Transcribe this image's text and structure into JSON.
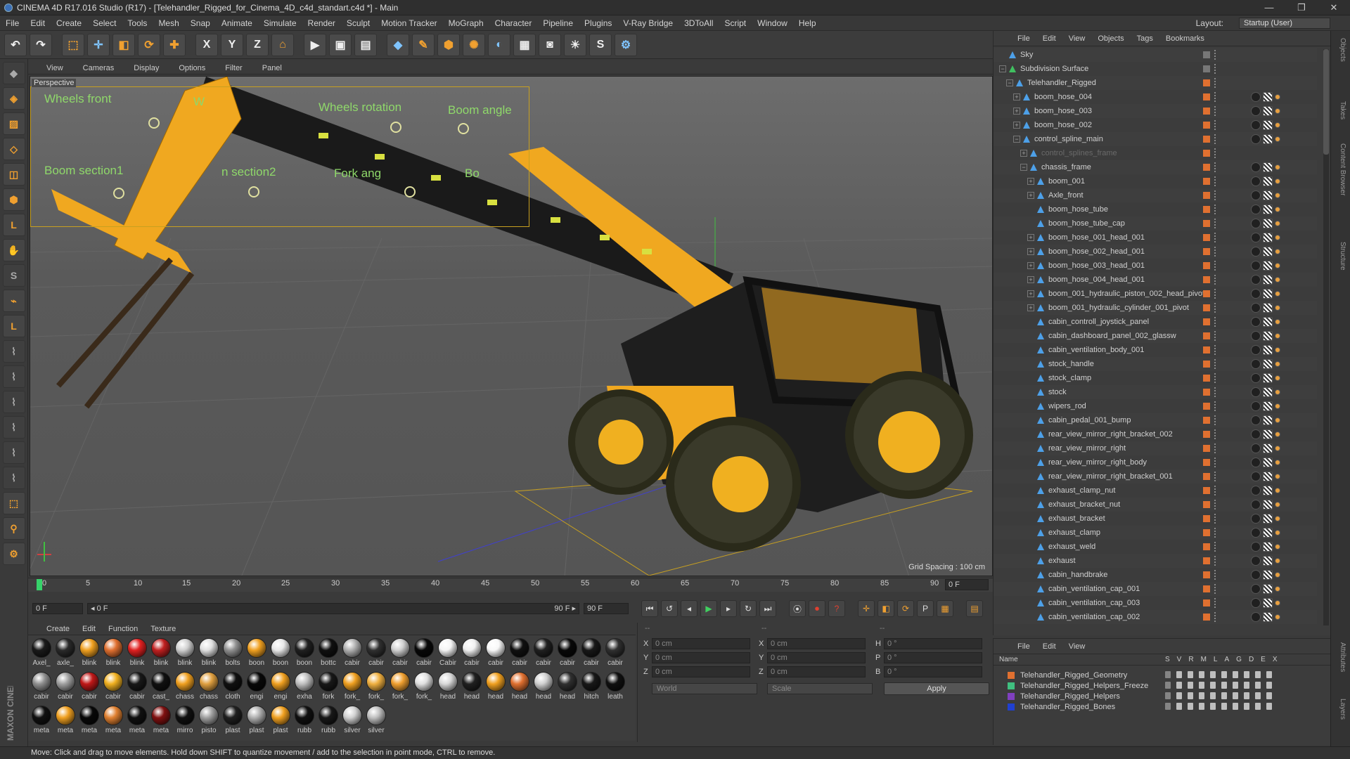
{
  "window": {
    "title": "CINEMA 4D R17.016 Studio (R17) - [Telehandler_Rigged_for_Cinema_4D_c4d_standart.c4d *] - Main",
    "minimize": "—",
    "maximize": "❐",
    "close": "✕"
  },
  "menubar": {
    "items": [
      "File",
      "Edit",
      "Create",
      "Select",
      "Tools",
      "Mesh",
      "Snap",
      "Animate",
      "Simulate",
      "Render",
      "Sculpt",
      "Motion Tracker",
      "MoGraph",
      "Character",
      "Pipeline",
      "Plugins",
      "V-Ray Bridge",
      "3DToAll",
      "Script",
      "Window",
      "Help"
    ],
    "layout_label": "Layout:",
    "layout_value": "Startup (User)"
  },
  "toolbar": {
    "undo": "↶",
    "redo": "↷",
    "select": "⬚",
    "move": "✛",
    "scale": "◧",
    "rotate": "⟳",
    "move2": "✚",
    "x": "X",
    "y": "Y",
    "z": "Z",
    "coord": "⌂",
    "render": "▶",
    "render2": "▣",
    "render3": "▤",
    "cube": "◆",
    "pen": "✎",
    "subdiv": "⬢",
    "array": "✺",
    "deform": "◐",
    "floor": "▦",
    "camera": "◙",
    "light": "☀",
    "python": "S",
    "python2": "⚙"
  },
  "left_tools": [
    "◆",
    "◈",
    "▨",
    "◇",
    "◫",
    "⬢",
    "L",
    "✋",
    "S",
    "⌁",
    "L",
    "⌇",
    "⌇",
    "⌇",
    "⌇",
    "⌇",
    "⌇",
    "⬚",
    "⚲",
    "⚙"
  ],
  "viewport": {
    "menu": [
      "View",
      "Cameras",
      "Display",
      "Options",
      "Filter",
      "Panel"
    ],
    "label": "Perspective",
    "grid_spacing": "Grid Spacing : 100 cm",
    "controls": [
      "Wheels front",
      "W",
      "Wheels rotation",
      "Boom angle",
      "Boom section1",
      "n section2",
      "Fork ang",
      "Bo"
    ]
  },
  "timeline": {
    "ticks": [
      "0",
      "5",
      "10",
      "15",
      "20",
      "25",
      "30",
      "35",
      "40",
      "45",
      "50",
      "55",
      "60",
      "65",
      "70",
      "75",
      "80",
      "85",
      "90"
    ],
    "frame_field": "0 F"
  },
  "transport": {
    "start_field": "0 F",
    "range_start": "◂ 0 F",
    "range_end": "90 F ▸",
    "end_field": "90 F",
    "buttons": [
      "⏮",
      "↺",
      "◂",
      "▶",
      "▸",
      "↻",
      "⏭",
      "⦿",
      "⏺",
      "?",
      "✛",
      "◧",
      "⟳",
      "P",
      "▦",
      "▤"
    ]
  },
  "materials": {
    "menu": [
      "Create",
      "Edit",
      "Function",
      "Texture"
    ],
    "items": [
      {
        "label": "Axel_",
        "color": "#1a1a1a"
      },
      {
        "label": "axle_",
        "color": "#2a2a2a"
      },
      {
        "label": "blink",
        "color": "#f0a020"
      },
      {
        "label": "blink",
        "color": "#e07030"
      },
      {
        "label": "blink",
        "color": "#e02020"
      },
      {
        "label": "blink",
        "color": "#c02020"
      },
      {
        "label": "blink",
        "color": "#d0d0d0"
      },
      {
        "label": "blink",
        "color": "#e0e0e0"
      },
      {
        "label": "bolts",
        "color": "#909090"
      },
      {
        "label": "boon",
        "color": "#f0a020"
      },
      {
        "label": "boon",
        "color": "#e8e8e8"
      },
      {
        "label": "boon",
        "color": "#202020"
      },
      {
        "label": "bottc",
        "color": "#101010"
      },
      {
        "label": "cabir",
        "color": "#b0b0b0"
      },
      {
        "label": "cabir",
        "color": "#303030"
      },
      {
        "label": "cabir",
        "color": "#d0d0d0"
      },
      {
        "label": "cabir",
        "color": "#080808"
      },
      {
        "label": "Cabir",
        "color": "#f4f4f4"
      },
      {
        "label": "cabir",
        "color": "#f0f0f0"
      },
      {
        "label": "cabir",
        "color": "#f8f8f8"
      },
      {
        "label": "cabir",
        "color": "#101010"
      },
      {
        "label": "cabir",
        "color": "#202020"
      },
      {
        "label": "cabir",
        "color": "#080808"
      },
      {
        "label": "cabir",
        "color": "#181818"
      },
      {
        "label": "cabir",
        "color": "#303030"
      },
      {
        "label": "cabir",
        "color": "#909090"
      },
      {
        "label": "cabir",
        "color": "#a0a0a0"
      },
      {
        "label": "cabir",
        "color": "#c01818"
      },
      {
        "label": "cabir",
        "color": "#f0b020"
      },
      {
        "label": "cabir",
        "color": "#181818"
      },
      {
        "label": "cast_",
        "color": "#101010"
      },
      {
        "label": "chass",
        "color": "#f0a020"
      },
      {
        "label": "chass",
        "color": "#e0a040"
      },
      {
        "label": "cloth",
        "color": "#101010"
      },
      {
        "label": "engi",
        "color": "#080808"
      },
      {
        "label": "engi",
        "color": "#f0a020"
      },
      {
        "label": "exha",
        "color": "#c0c0c0"
      },
      {
        "label": "fork",
        "color": "#181818"
      },
      {
        "label": "fork_",
        "color": "#f0a020"
      },
      {
        "label": "fork_",
        "color": "#f0b040"
      },
      {
        "label": "fork_",
        "color": "#f0a030"
      },
      {
        "label": "fork_",
        "color": "#e0e0e0"
      },
      {
        "label": "head",
        "color": "#d8d8d8"
      },
      {
        "label": "head",
        "color": "#202020"
      },
      {
        "label": "head",
        "color": "#f0a020"
      },
      {
        "label": "head",
        "color": "#e07030"
      },
      {
        "label": "head",
        "color": "#d0d0d0"
      },
      {
        "label": "head",
        "color": "#303030"
      },
      {
        "label": "hitch",
        "color": "#181818"
      },
      {
        "label": "leath",
        "color": "#101010"
      },
      {
        "label": "meta",
        "color": "#101010"
      },
      {
        "label": "meta",
        "color": "#f0a020"
      },
      {
        "label": "meta",
        "color": "#080808"
      },
      {
        "label": "meta",
        "color": "#e08030"
      },
      {
        "label": "meta",
        "color": "#101010"
      },
      {
        "label": "meta",
        "color": "#801010"
      },
      {
        "label": "mirro",
        "color": "#101010"
      },
      {
        "label": "pisto",
        "color": "#a0a0a0"
      },
      {
        "label": "plast",
        "color": "#202020"
      },
      {
        "label": "plast",
        "color": "#b0b0b0"
      },
      {
        "label": "plast",
        "color": "#f0a020"
      },
      {
        "label": "rubb",
        "color": "#101010"
      },
      {
        "label": "rubb",
        "color": "#181818"
      },
      {
        "label": "silver",
        "color": "#d0d0d0"
      },
      {
        "label": "silver",
        "color": "#c0c0c0"
      }
    ]
  },
  "coords": {
    "header1": "--",
    "header2": "--",
    "header3": "--",
    "x_label": "X",
    "y_label": "Y",
    "z_label": "Z",
    "h_label": "H",
    "p_label": "P",
    "b_label": "B",
    "pos_x": "0 cm",
    "pos_y": "0 cm",
    "pos_z": "0 cm",
    "size_x": "0 cm",
    "size_y": "0 cm",
    "size_z": "0 cm",
    "rot_h": "0 °",
    "rot_p": "0 °",
    "rot_b": "0 °",
    "space": "World",
    "mode": "Scale",
    "apply": "Apply"
  },
  "objects": {
    "menu": [
      "File",
      "Edit",
      "View",
      "Objects",
      "Tags",
      "Bookmarks"
    ],
    "rows": [
      {
        "name": "Sky",
        "indent": 0,
        "exp": ""
      },
      {
        "name": "Subdivision Surface",
        "indent": 0,
        "exp": "−"
      },
      {
        "name": "Telehandler_Rigged",
        "indent": 1,
        "exp": "−"
      },
      {
        "name": "boom_hose_004",
        "indent": 2,
        "exp": "+"
      },
      {
        "name": "boom_hose_003",
        "indent": 2,
        "exp": "+"
      },
      {
        "name": "boom_hose_002",
        "indent": 2,
        "exp": "+"
      },
      {
        "name": "control_spline_main",
        "indent": 2,
        "exp": "−"
      },
      {
        "name": "control_splines_frame",
        "indent": 3,
        "exp": "+"
      },
      {
        "name": "chassis_frame",
        "indent": 3,
        "exp": "−"
      },
      {
        "name": "boom_001",
        "indent": 4,
        "exp": "+"
      },
      {
        "name": "Axle_front",
        "indent": 4,
        "exp": "+"
      },
      {
        "name": "boom_hose_tube",
        "indent": 4,
        "exp": ""
      },
      {
        "name": "boom_hose_tube_cap",
        "indent": 4,
        "exp": ""
      },
      {
        "name": "boom_hose_001_head_001",
        "indent": 4,
        "exp": "+"
      },
      {
        "name": "boom_hose_002_head_001",
        "indent": 4,
        "exp": "+"
      },
      {
        "name": "boom_hose_003_head_001",
        "indent": 4,
        "exp": "+"
      },
      {
        "name": "boom_hose_004_head_001",
        "indent": 4,
        "exp": "+"
      },
      {
        "name": "boom_001_hydraulic_piston_002_head_pivot",
        "indent": 4,
        "exp": "+"
      },
      {
        "name": "boom_001_hydraulic_cylinder_001_pivot",
        "indent": 4,
        "exp": "+"
      },
      {
        "name": "cabin_controll_joystick_panel",
        "indent": 4,
        "exp": ""
      },
      {
        "name": "cabin_dashboard_panel_002_glassw",
        "indent": 4,
        "exp": ""
      },
      {
        "name": "cabin_ventilation_body_001",
        "indent": 4,
        "exp": ""
      },
      {
        "name": "stock_handle",
        "indent": 4,
        "exp": ""
      },
      {
        "name": "stock_clamp",
        "indent": 4,
        "exp": ""
      },
      {
        "name": "stock",
        "indent": 4,
        "exp": ""
      },
      {
        "name": "wipers_rod",
        "indent": 4,
        "exp": ""
      },
      {
        "name": "cabin_pedal_001_bump",
        "indent": 4,
        "exp": ""
      },
      {
        "name": "rear_view_mirror_right_bracket_002",
        "indent": 4,
        "exp": ""
      },
      {
        "name": "rear_view_mirror_right",
        "indent": 4,
        "exp": ""
      },
      {
        "name": "rear_view_mirror_right_body",
        "indent": 4,
        "exp": ""
      },
      {
        "name": "rear_view_mirror_right_bracket_001",
        "indent": 4,
        "exp": ""
      },
      {
        "name": "exhaust_clamp_nut",
        "indent": 4,
        "exp": ""
      },
      {
        "name": "exhaust_bracket_nut",
        "indent": 4,
        "exp": ""
      },
      {
        "name": "exhaust_bracket",
        "indent": 4,
        "exp": ""
      },
      {
        "name": "exhaust_clamp",
        "indent": 4,
        "exp": ""
      },
      {
        "name": "exhaust_weld",
        "indent": 4,
        "exp": ""
      },
      {
        "name": "exhaust",
        "indent": 4,
        "exp": ""
      },
      {
        "name": "cabin_handbrake",
        "indent": 4,
        "exp": ""
      },
      {
        "name": "cabin_ventilation_cap_001",
        "indent": 4,
        "exp": ""
      },
      {
        "name": "cabin_ventilation_cap_003",
        "indent": 4,
        "exp": ""
      },
      {
        "name": "cabin_ventilation_cap_002",
        "indent": 4,
        "exp": ""
      }
    ]
  },
  "layers": {
    "menu": [
      "File",
      "Edit",
      "View"
    ],
    "name_col": "Name",
    "cols": [
      "S",
      "V",
      "R",
      "M",
      "L",
      "A",
      "G",
      "D",
      "E",
      "X"
    ],
    "rows": [
      {
        "name": "Telehandler_Rigged_Geometry",
        "color": "#e07030"
      },
      {
        "name": "Telehandler_Rigged_Helpers_Freeze",
        "color": "#40c080"
      },
      {
        "name": "Telehandler_Rigged_Helpers",
        "color": "#8040c0"
      },
      {
        "name": "Telehandler_Rigged_Bones",
        "color": "#2040d0"
      }
    ]
  },
  "right_tabs": [
    "Objects",
    "Takes",
    "Content Browser",
    "Structure",
    "Attributes",
    "Layers"
  ],
  "status": "Move: Click and drag to move elements. Hold down SHIFT to quantize movement / add to the selection in point mode, CTRL to remove.",
  "maxon": "MAXON CINEMA 4D"
}
